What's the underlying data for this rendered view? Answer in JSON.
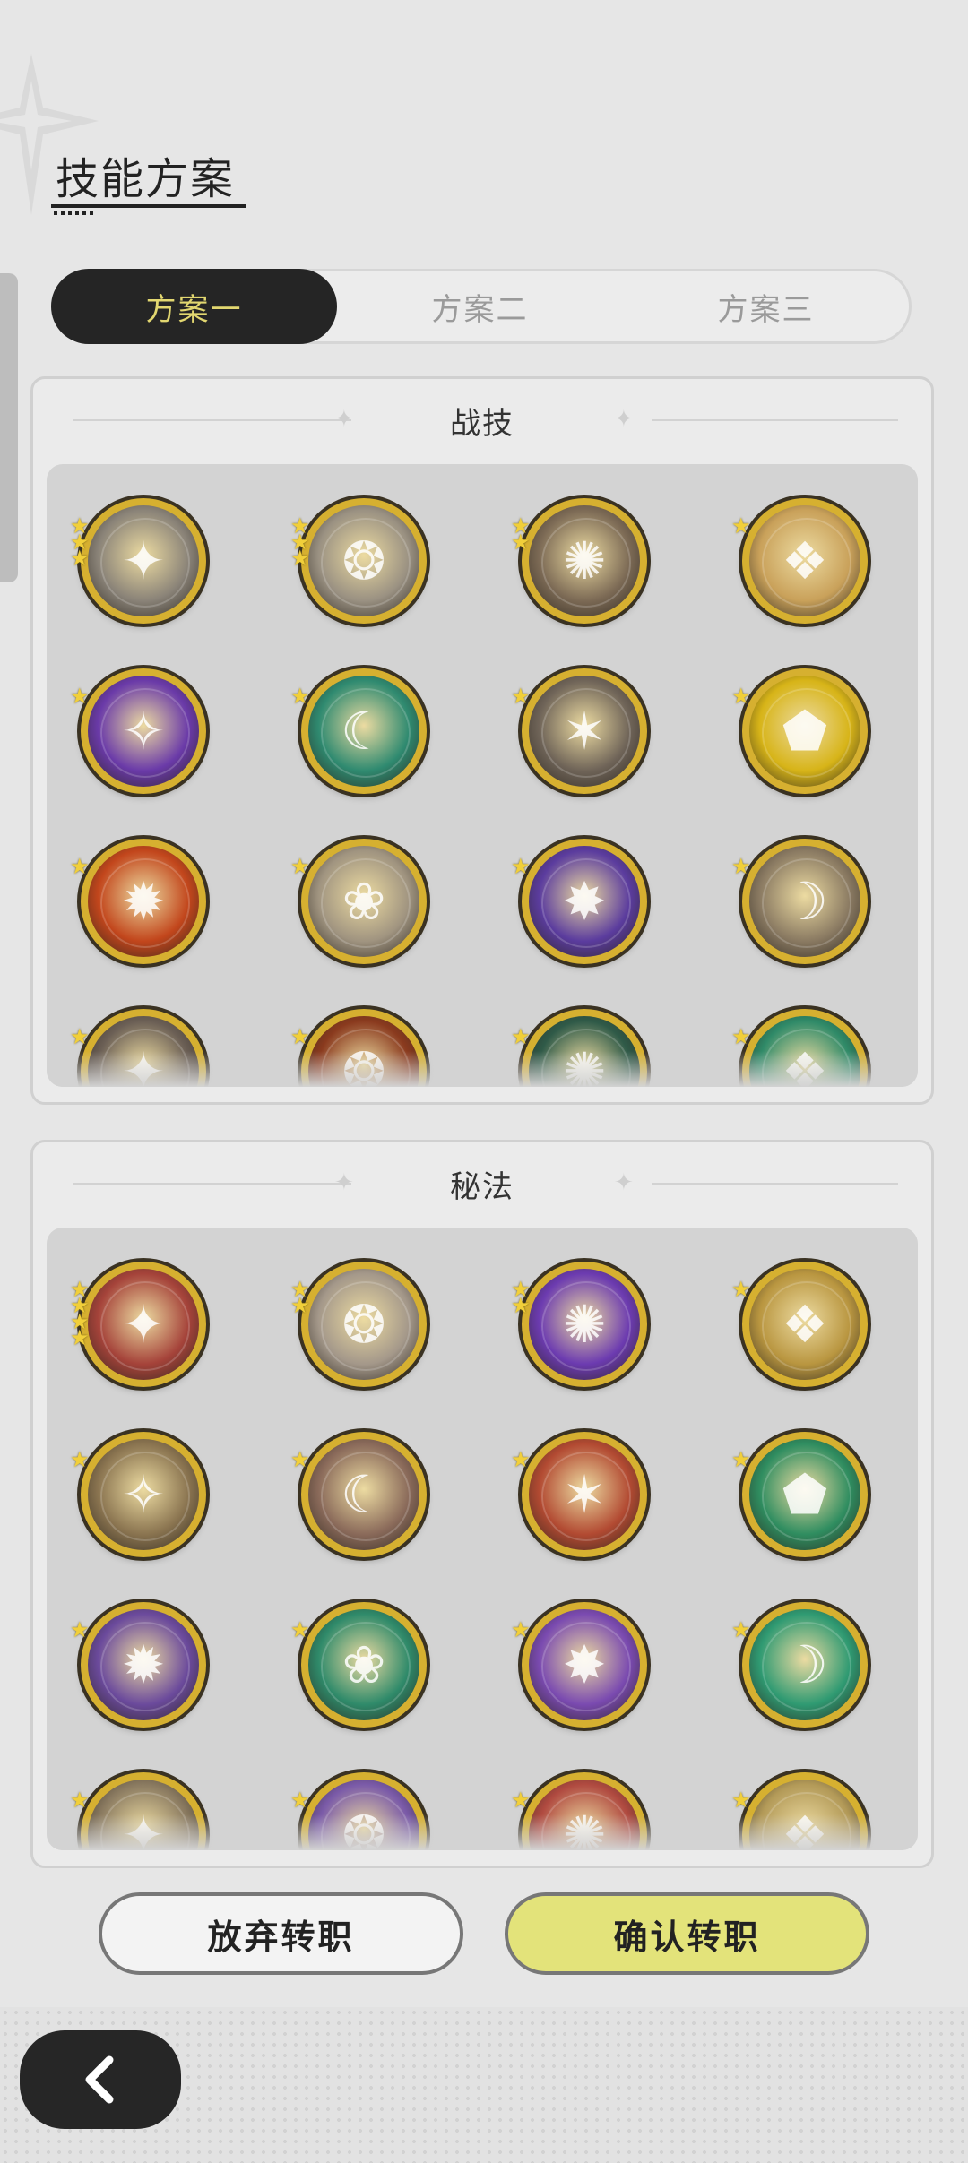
{
  "title": "技能方案",
  "tabs": [
    {
      "label": "方案一",
      "active": true
    },
    {
      "label": "方案二",
      "active": false
    },
    {
      "label": "方案三",
      "active": false
    }
  ],
  "sections": {
    "skills": {
      "title": "战技",
      "items": [
        {
          "icon": "wind-slash-icon",
          "stars": 3,
          "color": "#8a8378"
        },
        {
          "icon": "wind-gust-icon",
          "stars": 3,
          "color": "#9a9182"
        },
        {
          "icon": "ground-burst-icon",
          "stars": 2,
          "color": "#7c6a55"
        },
        {
          "icon": "golden-sweep-icon",
          "stars": 1,
          "color": "#c9a15a"
        },
        {
          "icon": "violet-heart-icon",
          "stars": 1,
          "color": "#6a3aa8"
        },
        {
          "icon": "jade-crescent-icon",
          "stars": 1,
          "color": "#2f8a70"
        },
        {
          "icon": "rock-spikes-icon",
          "stars": 1,
          "color": "#6f6458"
        },
        {
          "icon": "golden-shield-icon",
          "stars": 1,
          "color": "#d7b418"
        },
        {
          "icon": "fire-emblem-icon",
          "stars": 1,
          "color": "#c2461c"
        },
        {
          "icon": "spirit-beasts-icon",
          "stars": 1,
          "color": "#a09480"
        },
        {
          "icon": "shadow-claw-icon",
          "stars": 1,
          "color": "#5b3c9e"
        },
        {
          "icon": "crescent-blade-icon",
          "stars": 1,
          "color": "#8a7a62"
        },
        {
          "icon": "moon-slash-icon",
          "stars": 1,
          "color": "#6b5f55"
        },
        {
          "icon": "flame-arc-icon",
          "stars": 1,
          "color": "#8a3a1e"
        },
        {
          "icon": "sword-aura-icon",
          "stars": 1,
          "color": "#2f5a48"
        },
        {
          "icon": "arrow-rain-icon",
          "stars": 1,
          "color": "#2f8a68"
        }
      ]
    },
    "arcana": {
      "title": "秘法",
      "items": [
        {
          "icon": "crimson-storm-icon",
          "stars": 4,
          "color": "#a5433a"
        },
        {
          "icon": "stone-blade-icon",
          "stars": 2,
          "color": "#a4988a"
        },
        {
          "icon": "purple-flame-icon",
          "stars": 2,
          "color": "#6c3bb0"
        },
        {
          "icon": "golden-eye-icon",
          "stars": 1,
          "color": "#b99640"
        },
        {
          "icon": "dragon-sigil-icon",
          "stars": 1,
          "color": "#8a7450"
        },
        {
          "icon": "heart-shield-icon",
          "stars": 1,
          "color": "#8a6a5a"
        },
        {
          "icon": "rune-stone-icon",
          "stars": 1,
          "color": "#b24a32"
        },
        {
          "icon": "emerald-heart-icon",
          "stars": 1,
          "color": "#2f8d60"
        },
        {
          "icon": "shadow-wolf-icon",
          "stars": 1,
          "color": "#6b4a9c"
        },
        {
          "icon": "healing-circle-icon",
          "stars": 1,
          "color": "#2f8a6a"
        },
        {
          "icon": "radiant-figure-icon",
          "stars": 1,
          "color": "#7a4ab0"
        },
        {
          "icon": "jade-feather-icon",
          "stars": 1,
          "color": "#2f9a72"
        },
        {
          "icon": "moon-cross-icon",
          "stars": 1,
          "color": "#8a7a60"
        },
        {
          "icon": "violet-orb-icon",
          "stars": 1,
          "color": "#7a5aa8"
        },
        {
          "icon": "red-crystal-icon",
          "stars": 1,
          "color": "#b04a40"
        },
        {
          "icon": "golden-mask-icon",
          "stars": 1,
          "color": "#b39a58"
        }
      ]
    }
  },
  "buttons": {
    "cancel": "放弃转职",
    "confirm": "确认转职"
  },
  "colors": {
    "active_tab_bg": "#252525",
    "active_tab_text": "#e2d770",
    "confirm_bg": "#e3e37a",
    "icon_gold_ring": "#d6b030",
    "star": "#f1cf3a"
  }
}
